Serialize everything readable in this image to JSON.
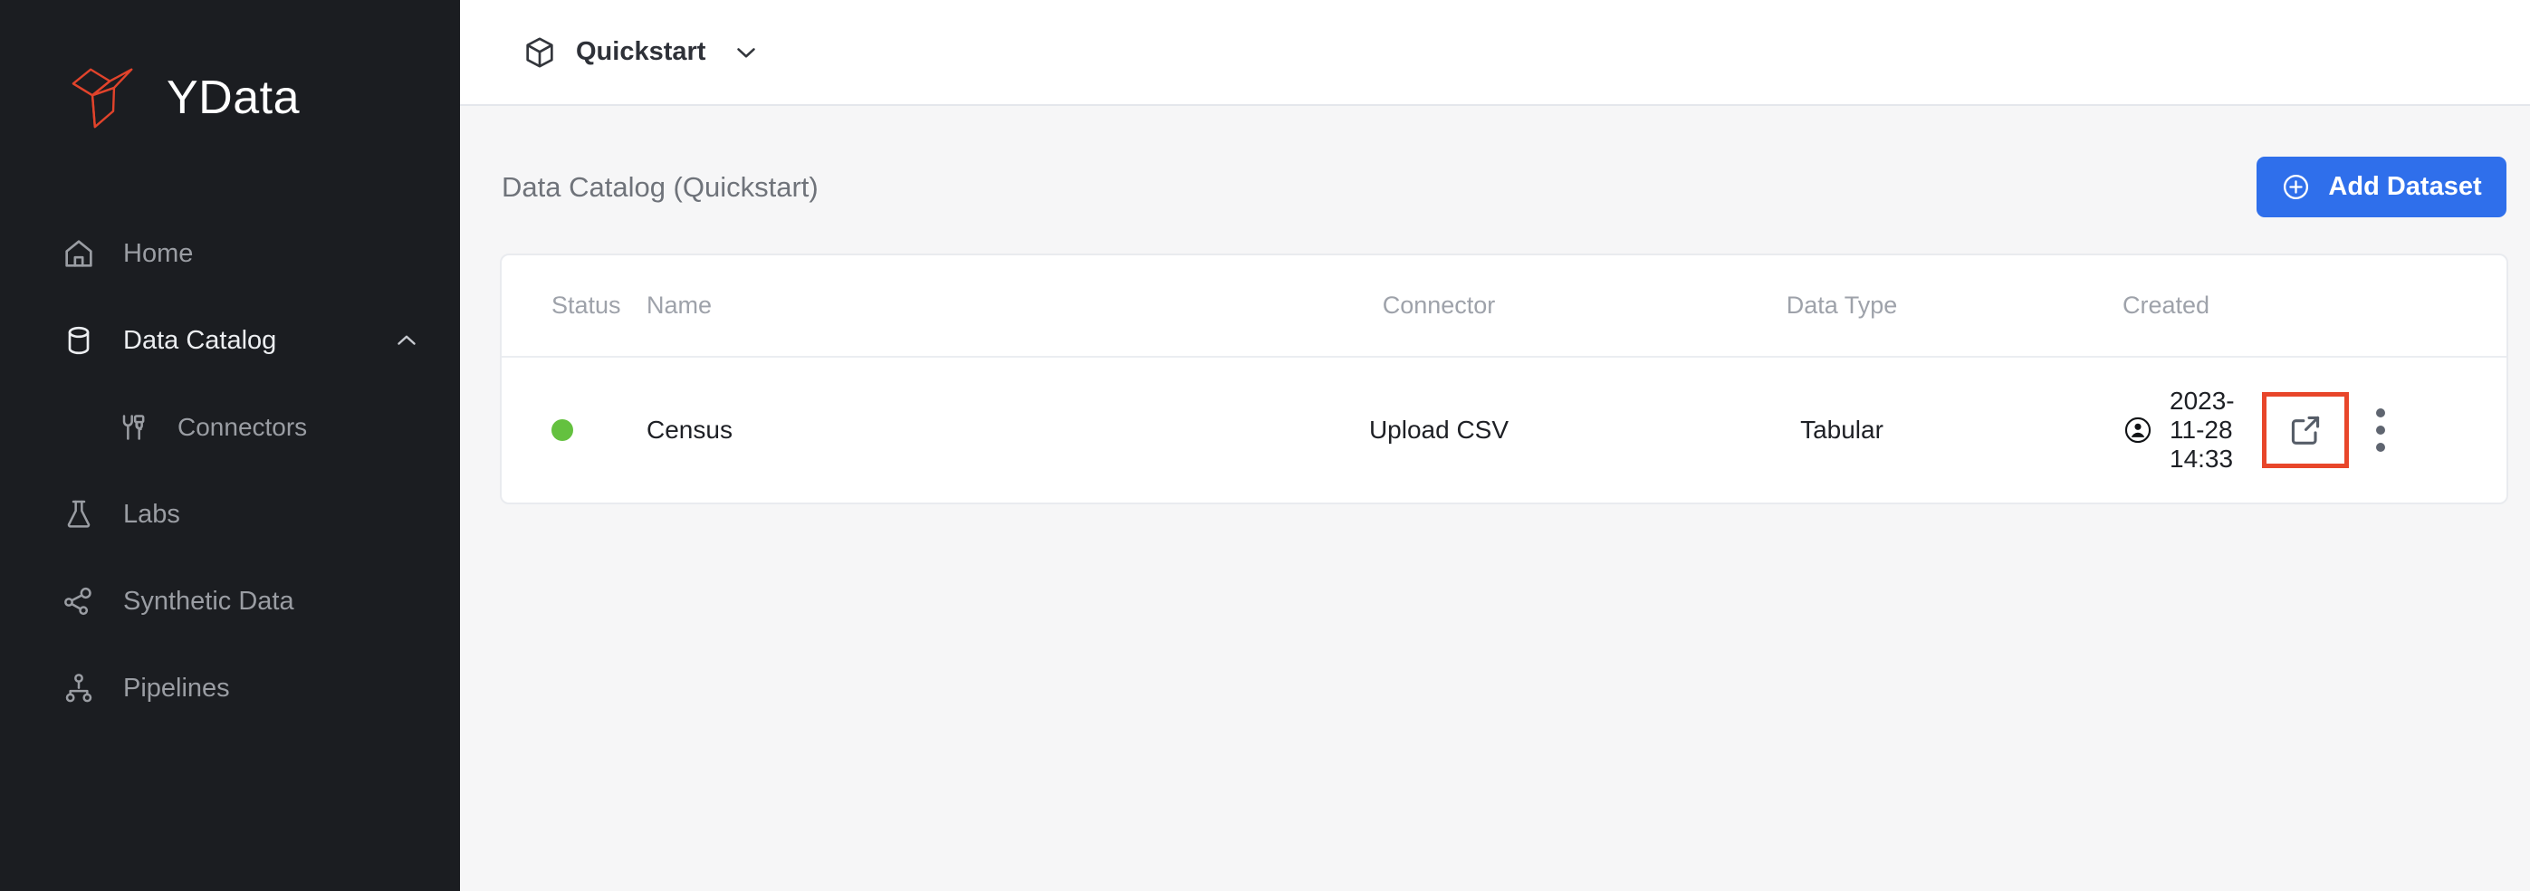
{
  "brand": {
    "name": "YData",
    "logo_icon": "ydata-logo-icon",
    "logo_color": "#e1432b"
  },
  "sidebar": {
    "background": "#1b1d21",
    "items": [
      {
        "label": "Home",
        "icon": "home-icon",
        "level": "top",
        "active": false
      },
      {
        "label": "Data Catalog",
        "icon": "database-icon",
        "level": "top",
        "active": true,
        "chevron": "chevron-up-icon"
      },
      {
        "label": "Connectors",
        "icon": "plug-icon",
        "level": "sub",
        "active": false
      },
      {
        "label": "Labs",
        "icon": "flask-icon",
        "level": "top",
        "active": false
      },
      {
        "label": "Synthetic Data",
        "icon": "share-nodes-icon",
        "level": "top",
        "active": false
      },
      {
        "label": "Pipelines",
        "icon": "pipeline-icon",
        "level": "top",
        "active": false
      }
    ]
  },
  "topbar": {
    "workspace_icon": "cube-icon",
    "workspace_name": "Quickstart",
    "caret_icon": "chevron-down-icon"
  },
  "page": {
    "title": "Data Catalog (Quickstart)",
    "add_button": {
      "label": "Add Dataset",
      "icon": "plus-circle-icon",
      "color": "#2f6feb"
    }
  },
  "table": {
    "columns": [
      "Status",
      "Name",
      "Connector",
      "Data Type",
      "Created"
    ],
    "rows": [
      {
        "status": "active",
        "status_color": "#64c13f",
        "name": "Census",
        "connector": "Upload CSV",
        "data_type": "Tabular",
        "created_icon": "user-circle-icon",
        "created": "2023-11-28 14:33",
        "actions": {
          "open_icon": "external-link-icon",
          "open_highlight_color": "#e8462a",
          "menu_icon": "kebab-menu-icon"
        }
      }
    ]
  }
}
